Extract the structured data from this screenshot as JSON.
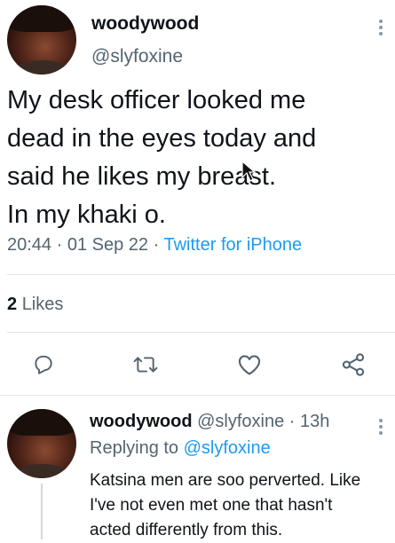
{
  "tweet": {
    "author_name": "woodywood",
    "author_handle": "@slyfoxine",
    "text_lines": [
      "My desk officer looked me",
      "dead in the eyes today and",
      "said he likes my breast.",
      "In my khaki o."
    ],
    "time": "20:44",
    "date": "01 Sep 22",
    "sep1": "·",
    "sep2": "·",
    "source": "Twitter for iPhone",
    "likes_count": "2",
    "likes_label": "Likes"
  },
  "actions": [
    {
      "icon": "reply-icon"
    },
    {
      "icon": "retweet-icon"
    },
    {
      "icon": "like-icon"
    },
    {
      "icon": "share-icon"
    }
  ],
  "reply": {
    "author_name": "woodywood",
    "author_handle": "@slyfoxine",
    "sep": "·",
    "age": "13h",
    "replying_prefix": "Replying to",
    "replying_handle": "@slyfoxine",
    "text_lines": [
      "Katsina men are soo perverted. Like",
      "I've not even met one that hasn't",
      "acted differently from this."
    ]
  },
  "colors": {
    "accent": "#1d9bf0",
    "muted": "#536471",
    "text": "#0f1419"
  }
}
